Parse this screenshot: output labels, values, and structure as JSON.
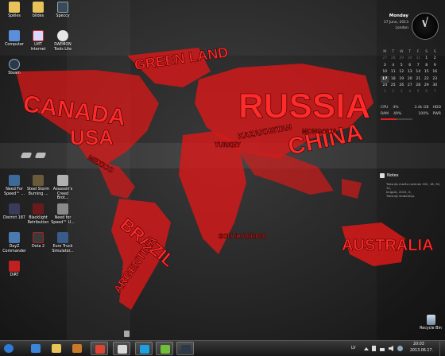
{
  "desktop_icons": [
    {
      "label": "Spēles",
      "icon": "folder-icon",
      "color": "#e8c35a"
    },
    {
      "label": "bildes",
      "icon": "folder-icon",
      "color": "#e8c35a"
    },
    {
      "label": "Speccy",
      "icon": "speccy-icon",
      "color": "#3a4a5a"
    },
    {
      "label": "Computer",
      "icon": "computer-icon",
      "color": "#5b8fd9"
    },
    {
      "label": "LMT Internet",
      "icon": "lmt-internet-icon",
      "color": "#d9d9ff"
    },
    {
      "label": "DAEMON\nTools Lite",
      "icon": "daemon-tools-icon",
      "color": "#e6e6e6"
    },
    {
      "label": "Steam",
      "icon": "steam-icon",
      "color": "#2b3a4a"
    },
    {
      "label": "Need For\nSpeed™ ...",
      "icon": "game-icon",
      "color": "#3c6a9a"
    },
    {
      "label": "Steel Storm\nBurning ...",
      "icon": "game-icon",
      "color": "#6a5a3a"
    },
    {
      "label": "Assassin's\nCreed Brot...",
      "icon": "game-icon",
      "color": "#b0b0b0"
    },
    {
      "label": "District 187",
      "icon": "game-icon",
      "color": "#3a3a5a"
    },
    {
      "label": "Blacklight\nRetribution",
      "icon": "game-icon",
      "color": "#6a1a1a"
    },
    {
      "label": "Need for\nSpeed™ U...",
      "icon": "game-icon",
      "color": "#8a8a8a"
    },
    {
      "label": "DayZ\nCommander",
      "icon": "game-icon",
      "color": "#4a7ab0"
    },
    {
      "label": "Dota 2",
      "icon": "dota-icon",
      "color": "#3a3a3a"
    },
    {
      "label": "Euro Truck\nSimulator...",
      "icon": "game-icon",
      "color": "#3a5a8a"
    },
    {
      "label": "DiRT",
      "icon": "dirt-icon",
      "color": "#c02020"
    },
    {
      "label": "Recycle Bin",
      "icon": "recycle-bin-icon",
      "color": "#9ab"
    }
  ],
  "wallpaper": {
    "words": [
      "GREEN\nLAND",
      "CANADA",
      "USA",
      "RUSSIA",
      "CHINA",
      "MONGOLIA",
      "KAZAKHSTAN",
      "BRAZIL",
      "ARGENTINA",
      "AUSTRALIA",
      "MEXICO",
      "SOUTH\nAFRICA",
      "TURKEY"
    ],
    "accent": "#e01818"
  },
  "clock": {
    "day": "Monday",
    "date": "17 June, 2013",
    "city": "London"
  },
  "calendar": {
    "headers": [
      "M",
      "T",
      "W",
      "T",
      "F",
      "S",
      "S"
    ],
    "weeks": [
      [
        "27",
        "28",
        "29",
        "30",
        "31",
        "1",
        "2"
      ],
      [
        "3",
        "4",
        "5",
        "6",
        "7",
        "8",
        "9"
      ],
      [
        "10",
        "11",
        "12",
        "13",
        "14",
        "15",
        "16"
      ],
      [
        "17",
        "18",
        "19",
        "20",
        "21",
        "22",
        "23"
      ],
      [
        "24",
        "25",
        "26",
        "27",
        "28",
        "29",
        "30"
      ],
      [
        "1",
        "2",
        "3",
        "4",
        "5",
        "6",
        "7"
      ]
    ],
    "today": "17"
  },
  "sysmon": {
    "cpu_label": "CPU",
    "cpu_value": "4%",
    "cpu_fraction": 0.04,
    "ram_label": "RAM",
    "ram_value": "49%",
    "ram_fraction": 0.49,
    "mem_total": "3.4k GB",
    "hdd_label": "HDD",
    "pct_100": "100%",
    "pwr_label": "PWR"
  },
  "notes": {
    "title": "Notes",
    "body": "Tuksnijs maršu rocknes 102, 18, 30, 12,\nkniguīs, 2012, 0,\nTuksnijs studentiju."
  },
  "taskbar": {
    "apps": [
      {
        "name": "start-button",
        "color": "#2e7bd6"
      },
      {
        "name": "internet-explorer-button",
        "color": "#3a86d9"
      },
      {
        "name": "file-explorer-button",
        "color": "#e8c35a"
      },
      {
        "name": "media-player-button",
        "color": "#c87a2a"
      },
      {
        "name": "chrome-button",
        "color": "#dd4433"
      },
      {
        "name": "pdf-reader-button",
        "color": "#d8d8d8"
      },
      {
        "name": "skype-button",
        "color": "#1ea0e0"
      },
      {
        "name": "utorrent-button",
        "color": "#6fbf3a"
      },
      {
        "name": "steam-button",
        "color": "#2b3a4a"
      }
    ],
    "language": "LV",
    "time": "20:03",
    "date": "2013.06.17."
  }
}
